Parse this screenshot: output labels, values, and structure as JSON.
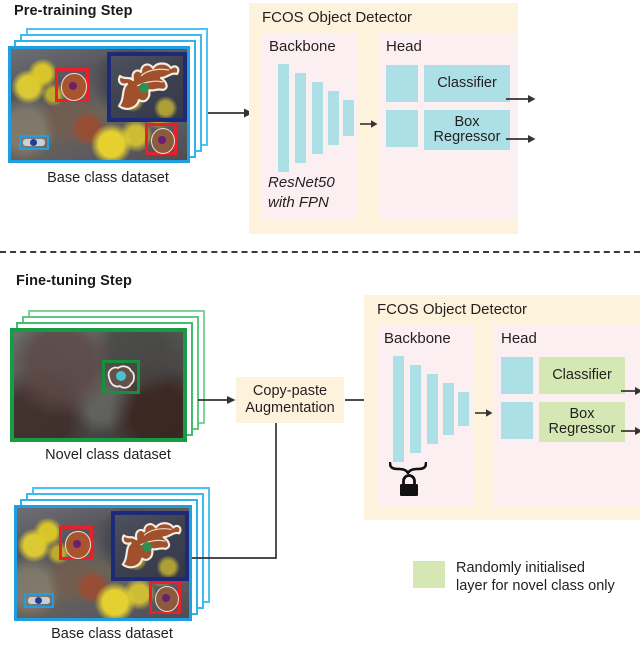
{
  "pretraining": {
    "title": "Pre-training Step",
    "dataset_caption": "Base class dataset",
    "detector": {
      "title": "FCOS Object Detector",
      "backbone_label": "Backbone",
      "backbone_note_line1": "ResNet50",
      "backbone_note_line2": "with FPN",
      "head_label": "Head",
      "classifier_label": "Classifier",
      "box_regressor_line1": "Box",
      "box_regressor_line2": "Regressor"
    }
  },
  "finetuning": {
    "title": "Fine-tuning Step",
    "novel_caption": "Novel class dataset",
    "base_caption": "Base class dataset",
    "augmentation_line1": "Copy-paste",
    "augmentation_line2": "Augmentation",
    "detector": {
      "title": "FCOS Object Detector",
      "backbone_label": "Backbone",
      "head_label": "Head",
      "classifier_label": "Classifier",
      "box_regressor_line1": "Box",
      "box_regressor_line2": "Regressor",
      "frozen_icon": "lock-icon"
    }
  },
  "legend": {
    "line1": "Randomly initialised",
    "line2": "layer for novel class only",
    "swatch_color": "#d5e8b4"
  },
  "colors": {
    "panel_yellow": "#fdf3dc",
    "panel_pink": "#fceff2",
    "layer_cyan": "#ace0e6",
    "novel_green": "#d5e8b4",
    "base_stack_border": "#29a3e0",
    "novel_stack_border": "#1fa94a",
    "annotation_red": "#e8202a",
    "annotation_navy": "#1c2a78",
    "annotation_green": "#16903c",
    "divider": "#3a3a3a"
  }
}
